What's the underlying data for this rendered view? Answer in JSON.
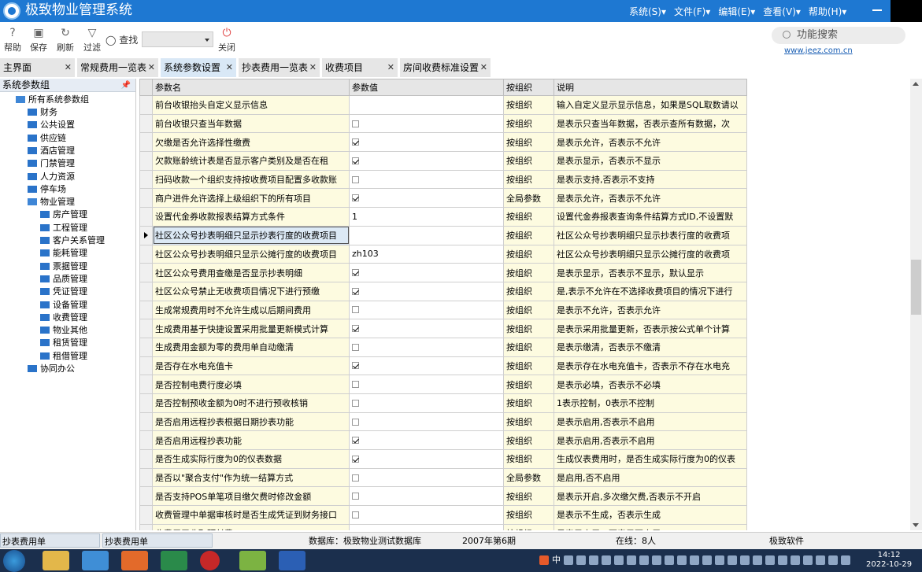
{
  "app": {
    "title": "极致物业管理系统"
  },
  "menu": [
    "系统(S)▾",
    "文件(F)▾",
    "编辑(E)▾",
    "查看(V)▾",
    "帮助(H)▾"
  ],
  "toolbar": {
    "help": "帮助",
    "save": "保存",
    "refresh": "刷新",
    "filter": "过滤",
    "search": "查找",
    "close": "关闭",
    "func_search": "功能搜索",
    "site": "www.jeez.com.cn"
  },
  "tabs": [
    "主界面",
    "常规费用一览表",
    "系统参数设置",
    "抄表费用一览表",
    "收费项目",
    "房间收费标准设置"
  ],
  "left_panel": {
    "title": "系统参数组",
    "root": "所有系统参数组",
    "groups": [
      "财务",
      "公共设置",
      "供应链",
      "酒店管理",
      "门禁管理",
      "人力资源",
      "停车场",
      "物业管理"
    ],
    "sub_groups": [
      "房产管理",
      "工程管理",
      "客户关系管理",
      "能耗管理",
      "票据管理",
      "品质管理",
      "凭证管理",
      "设备管理",
      "收费管理",
      "物业其他",
      "租赁管理",
      "租借管理"
    ],
    "last": "协同办公"
  },
  "grid": {
    "columns": [
      "参数名",
      "参数值",
      "按组织",
      "说明"
    ],
    "rows": [
      {
        "name": "前台收银抬头自定义显示信息",
        "value": "",
        "cb": null,
        "org": "按组织",
        "desc": "输入自定义显示显示信息，如果是SQL取数请以"
      },
      {
        "name": "前台收银只查当年数据",
        "value": "",
        "cb": false,
        "org": "按组织",
        "desc": "是表示只查当年数据，否表示查所有数据，次"
      },
      {
        "name": "欠缴是否允许选择性缴费",
        "value": "",
        "cb": true,
        "org": "按组织",
        "desc": "是表示允许，否表示不允许"
      },
      {
        "name": "欠款账龄统计表是否显示客户类别及是否在租",
        "value": "",
        "cb": true,
        "org": "按组织",
        "desc": "是表示显示，否表示不显示"
      },
      {
        "name": "扫码收款一个组织支持按收费项目配置多收款账",
        "value": "",
        "cb": false,
        "org": "按组织",
        "desc": "是表示支持,否表示不支持"
      },
      {
        "name": "商户进件允许选择上级组织下的所有项目",
        "value": "",
        "cb": true,
        "org": "全局参数",
        "desc": "是表示允许，否表示不允许"
      },
      {
        "name": "设置代金券收款报表结算方式条件",
        "value": "1",
        "cb": null,
        "org": "按组织",
        "desc": "设置代金券报表查询条件结算方式ID,不设置默"
      },
      {
        "name": "社区公众号抄表明细只显示抄表行度的收费项目",
        "value": "",
        "cb": null,
        "org": "按组织",
        "desc": "社区公众号抄表明细只显示抄表行度的收费项",
        "selected": true
      },
      {
        "name": "社区公众号抄表明细只显示公摊行度的收费项目",
        "value": "zh103",
        "cb": null,
        "org": "按组织",
        "desc": "社区公众号抄表明细只显示公摊行度的收费项"
      },
      {
        "name": "社区公众号费用查缴是否显示抄表明细",
        "value": "",
        "cb": true,
        "org": "按组织",
        "desc": "是表示显示，否表示不显示，默认显示"
      },
      {
        "name": "社区公众号禁止无收费项目情况下进行预缴",
        "value": "",
        "cb": true,
        "org": "按组织",
        "desc": "是,表示不允许在不选择收费项目的情况下进行"
      },
      {
        "name": "生成常规费用时不允许生成以后期间费用",
        "value": "",
        "cb": false,
        "org": "按组织",
        "desc": "是表示不允许，否表示允许"
      },
      {
        "name": "生成费用基于快捷设置采用批量更新模式计算",
        "value": "",
        "cb": true,
        "org": "按组织",
        "desc": "是表示采用批量更新，否表示按公式单个计算"
      },
      {
        "name": "生成费用金额为零的费用单自动缴清",
        "value": "",
        "cb": false,
        "org": "按组织",
        "desc": "是表示缴清，否表示不缴清"
      },
      {
        "name": "是否存在水电充值卡",
        "value": "",
        "cb": true,
        "org": "按组织",
        "desc": "是表示存在水电充值卡，否表示不存在水电充"
      },
      {
        "name": "是否控制电费行度必填",
        "value": "",
        "cb": false,
        "org": "按组织",
        "desc": "是表示必填，否表示不必填"
      },
      {
        "name": "是否控制预收金额为0时不进行预收核销",
        "value": "",
        "cb": false,
        "org": "按组织",
        "desc": "1表示控制，0表示不控制"
      },
      {
        "name": "是否启用远程抄表根据日期抄表功能",
        "value": "",
        "cb": false,
        "org": "按组织",
        "desc": "是表示启用,否表示不启用"
      },
      {
        "name": "是否启用远程抄表功能",
        "value": "",
        "cb": true,
        "org": "按组织",
        "desc": "是表示启用,否表示不启用"
      },
      {
        "name": "是否生成实际行度为0的仪表数据",
        "value": "",
        "cb": true,
        "org": "按组织",
        "desc": "生成仪表费用时，是否生成实际行度为0的仪表"
      },
      {
        "name": "是否以\"聚合支付\"作为统一结算方式",
        "value": "",
        "cb": false,
        "org": "全局参数",
        "desc": "是启用,否不启用"
      },
      {
        "name": "是否支持POS单笔项目缴欠费时修改金额",
        "value": "",
        "cb": false,
        "org": "按组织",
        "desc": "是表示开启,多次缴欠费,否表示不开启"
      },
      {
        "name": "收费管理中单据审核时是否生成凭证到财务接口",
        "value": "",
        "cb": false,
        "org": "按组织",
        "desc": "是表示不生成，否表示生成"
      },
      {
        "name": "收费用于收取预付费",
        "value": "",
        "cb": null,
        "org": "按组织",
        "desc": "是表示启用，否表示不启用"
      }
    ]
  },
  "status": {
    "btn1": "抄表费用单",
    "btn2": "抄表费用单",
    "db": "数据库：极致物业测试数据库",
    "period": "2007年第6期",
    "online": "在线：8人",
    "company": "极致软件"
  },
  "clock": {
    "time": "14:12",
    "date": "2022-10-29"
  },
  "ime": "中"
}
